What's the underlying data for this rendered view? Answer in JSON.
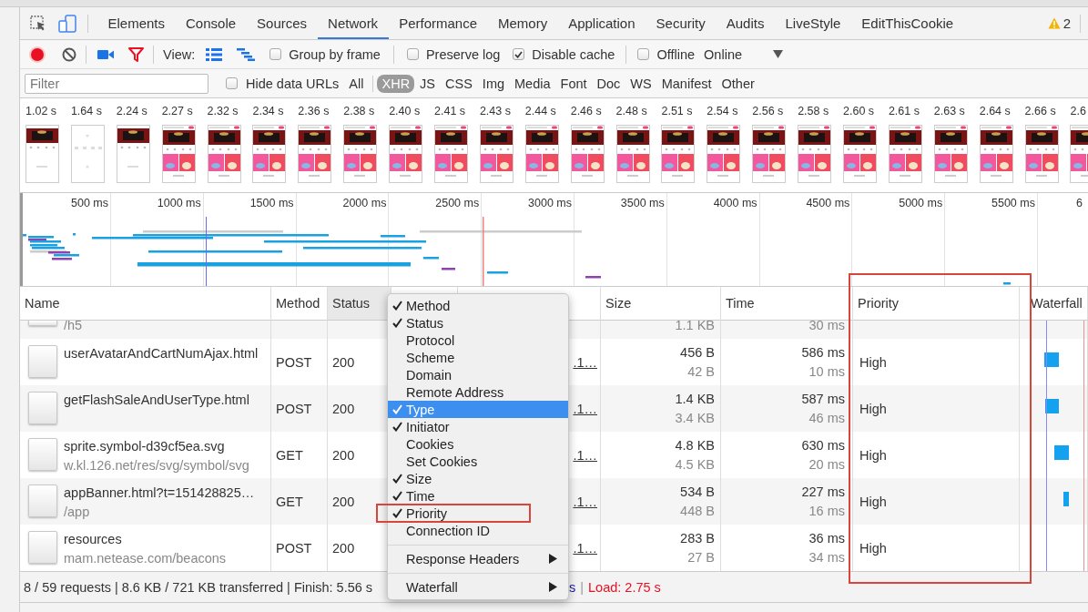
{
  "tabs": [
    {
      "label": "Elements",
      "selected": false
    },
    {
      "label": "Console",
      "selected": false
    },
    {
      "label": "Sources",
      "selected": false
    },
    {
      "label": "Network",
      "selected": true
    },
    {
      "label": "Performance",
      "selected": false
    },
    {
      "label": "Memory",
      "selected": false
    },
    {
      "label": "Application",
      "selected": false
    },
    {
      "label": "Security",
      "selected": false
    },
    {
      "label": "Audits",
      "selected": false
    },
    {
      "label": "LiveStyle",
      "selected": false
    },
    {
      "label": "EditThisCookie",
      "selected": false
    }
  ],
  "warnings": {
    "count": "2"
  },
  "toolbar": {
    "view_label": "View:",
    "group_by_frame": {
      "label": "Group by frame",
      "checked": false
    },
    "preserve_log": {
      "label": "Preserve log",
      "checked": false
    },
    "disable_cache": {
      "label": "Disable cache",
      "checked": true
    },
    "offline": {
      "label": "Offline",
      "checked": false
    },
    "throttling": "Online"
  },
  "filter": {
    "placeholder": "Filter",
    "hide_data_urls": {
      "label": "Hide data URLs",
      "checked": false
    },
    "types": [
      {
        "label": "All",
        "selected": false
      },
      {
        "label": "XHR",
        "selected": true
      },
      {
        "label": "JS",
        "selected": false
      },
      {
        "label": "CSS",
        "selected": false
      },
      {
        "label": "Img",
        "selected": false
      },
      {
        "label": "Media",
        "selected": false
      },
      {
        "label": "Font",
        "selected": false
      },
      {
        "label": "Doc",
        "selected": false
      },
      {
        "label": "WS",
        "selected": false
      },
      {
        "label": "Manifest",
        "selected": false
      },
      {
        "label": "Other",
        "selected": false
      }
    ]
  },
  "filmstrip": [
    {
      "time": "1.02 s",
      "kind": "picture"
    },
    {
      "time": "1.64 s",
      "kind": "picture"
    },
    {
      "time": "2.24 s",
      "kind": "picture"
    },
    {
      "time": "2.27 s",
      "kind": "picture"
    },
    {
      "time": "2.32 s",
      "kind": "picture"
    },
    {
      "time": "2.34 s",
      "kind": "picture"
    },
    {
      "time": "2.36 s",
      "kind": "picture"
    },
    {
      "time": "2.38 s",
      "kind": "picture"
    },
    {
      "time": "2.40 s",
      "kind": "picture"
    },
    {
      "time": "2.41 s",
      "kind": "picture"
    },
    {
      "time": "2.43 s",
      "kind": "picture"
    },
    {
      "time": "2.44 s",
      "kind": "picture"
    },
    {
      "time": "2.46 s",
      "kind": "picture"
    },
    {
      "time": "2.48 s",
      "kind": "picture"
    },
    {
      "time": "2.51 s",
      "kind": "picture"
    },
    {
      "time": "2.54 s",
      "kind": "picture"
    },
    {
      "time": "2.56 s",
      "kind": "picture"
    },
    {
      "time": "2.58 s",
      "kind": "picture"
    },
    {
      "time": "2.60 s",
      "kind": "picture"
    },
    {
      "time": "2.61 s",
      "kind": "picture"
    },
    {
      "time": "2.63 s",
      "kind": "picture"
    },
    {
      "time": "2.64 s",
      "kind": "picture"
    },
    {
      "time": "2.66 s",
      "kind": "picture"
    },
    {
      "time": "2.6",
      "kind": "picture"
    }
  ],
  "overview": {
    "ruler": [
      "500 ms",
      "1000 ms",
      "1500 ms",
      "2000 ms",
      "2500 ms",
      "3000 ms",
      "3500 ms",
      "4000 ms",
      "4500 ms",
      "5000 ms",
      "5500 ms",
      "6"
    ]
  },
  "table": {
    "columns": [
      {
        "label": "Name",
        "highlighted": false
      },
      {
        "label": "Method",
        "highlighted": false
      },
      {
        "label": "Status",
        "highlighted": true
      },
      {
        "label": "Size",
        "highlighted": false
      },
      {
        "label": "Time",
        "highlighted": false
      },
      {
        "label": "Priority",
        "highlighted": false
      },
      {
        "label": "Waterfall",
        "highlighted": false
      }
    ],
    "partial_row": {
      "path": "/h5",
      "resource_size": "1.1 KB",
      "latency": "30 ms"
    },
    "rows": [
      {
        "name": "userAvatarAndCartNumAjax.html",
        "method": "POST",
        "status": "200",
        "initiator": ".1…",
        "size": "456 B",
        "resource_size": "42 B",
        "time": "586 ms",
        "latency": "10 ms",
        "priority": "High"
      },
      {
        "name": "getFlashSaleAndUserType.html",
        "method": "POST",
        "status": "200",
        "initiator": ".1…",
        "size": "1.4 KB",
        "resource_size": "3.4 KB",
        "time": "587 ms",
        "latency": "46 ms",
        "priority": "High"
      },
      {
        "name": "sprite.symbol-d39cf5ea.svg",
        "path": "w.kl.126.net/res/svg/symbol/svg",
        "method": "GET",
        "status": "200",
        "initiator": ".1…",
        "size": "4.8 KB",
        "resource_size": "4.5 KB",
        "time": "630 ms",
        "latency": "20 ms",
        "priority": "High"
      },
      {
        "name": "appBanner.html?t=151428825…",
        "path": "/app",
        "method": "GET",
        "status": "200",
        "initiator": ".1…",
        "size": "534 B",
        "resource_size": "448 B",
        "time": "227 ms",
        "latency": "16 ms",
        "priority": "High"
      },
      {
        "name": "resources",
        "path": "mam.netease.com/beacons",
        "method": "POST",
        "status": "200",
        "initiator": ".1…",
        "size": "283 B",
        "resource_size": "27 B",
        "time": "36 ms",
        "latency": "34 ms",
        "priority": "High"
      }
    ]
  },
  "status_bar": {
    "summary": "8 / 59 requests | 8.6 KB / 721 KB transferred | Finish: 5.56 s",
    "dom_content_loaded": "s",
    "separator": "|",
    "load": "Load: 2.75 s"
  },
  "context_menu": {
    "items": [
      {
        "kind": "toggle",
        "label": "Method",
        "checked": true,
        "selected": false
      },
      {
        "kind": "toggle",
        "label": "Status",
        "checked": true,
        "selected": false
      },
      {
        "kind": "toggle",
        "label": "Protocol",
        "checked": false,
        "selected": false
      },
      {
        "kind": "toggle",
        "label": "Scheme",
        "checked": false,
        "selected": false
      },
      {
        "kind": "toggle",
        "label": "Domain",
        "checked": false,
        "selected": false
      },
      {
        "kind": "toggle",
        "label": "Remote Address",
        "checked": false,
        "selected": false
      },
      {
        "kind": "toggle",
        "label": "Type",
        "checked": true,
        "selected": true
      },
      {
        "kind": "toggle",
        "label": "Initiator",
        "checked": true,
        "selected": false
      },
      {
        "kind": "toggle",
        "label": "Cookies",
        "checked": false,
        "selected": false
      },
      {
        "kind": "toggle",
        "label": "Set Cookies",
        "checked": false,
        "selected": false
      },
      {
        "kind": "toggle",
        "label": "Size",
        "checked": true,
        "selected": false
      },
      {
        "kind": "toggle",
        "label": "Time",
        "checked": true,
        "selected": false
      },
      {
        "kind": "toggle",
        "label": "Priority",
        "checked": true,
        "selected": false
      },
      {
        "kind": "toggle",
        "label": "Connection ID",
        "checked": false,
        "selected": false
      },
      {
        "kind": "separator"
      },
      {
        "kind": "submenu",
        "label": "Response Headers",
        "selected": false
      },
      {
        "kind": "separator"
      },
      {
        "kind": "submenu",
        "label": "Waterfall",
        "selected": false
      }
    ]
  }
}
